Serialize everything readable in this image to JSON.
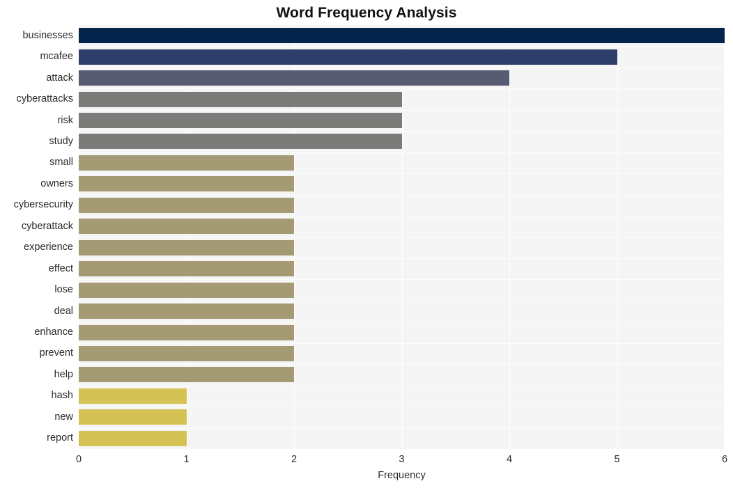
{
  "chart_data": {
    "type": "bar",
    "orientation": "horizontal",
    "title": "Word Frequency Analysis",
    "xlabel": "Frequency",
    "ylabel": "",
    "xlim": [
      0,
      6
    ],
    "xticks": [
      "0",
      "1",
      "2",
      "3",
      "4",
      "5",
      "6"
    ],
    "grid": true,
    "legend": "none",
    "categories": [
      "businesses",
      "mcafee",
      "attack",
      "cyberattacks",
      "risk",
      "study",
      "small",
      "owners",
      "cybersecurity",
      "cyberattack",
      "experience",
      "effect",
      "lose",
      "deal",
      "enhance",
      "prevent",
      "help",
      "hash",
      "new",
      "report"
    ],
    "values": [
      6,
      5,
      4,
      3,
      3,
      3,
      2,
      2,
      2,
      2,
      2,
      2,
      2,
      2,
      2,
      2,
      2,
      1,
      1,
      1
    ],
    "bar_colors": [
      "#04244c",
      "#2f3f6b",
      "#585c72",
      "#7b7b79",
      "#7b7b79",
      "#7b7b79",
      "#a49a74",
      "#a49a74",
      "#a49a74",
      "#a49a74",
      "#a49a74",
      "#a49a74",
      "#a49a74",
      "#a49a74",
      "#a49a74",
      "#a49a74",
      "#a49a74",
      "#d4c255",
      "#d4c255",
      "#d4c255"
    ]
  },
  "style": {
    "plot_background": "#f5f5f5",
    "page_background": "#ffffff",
    "gridline_color": "#ffffff",
    "text_color": "#2b2b2b",
    "title_color": "#111111"
  }
}
